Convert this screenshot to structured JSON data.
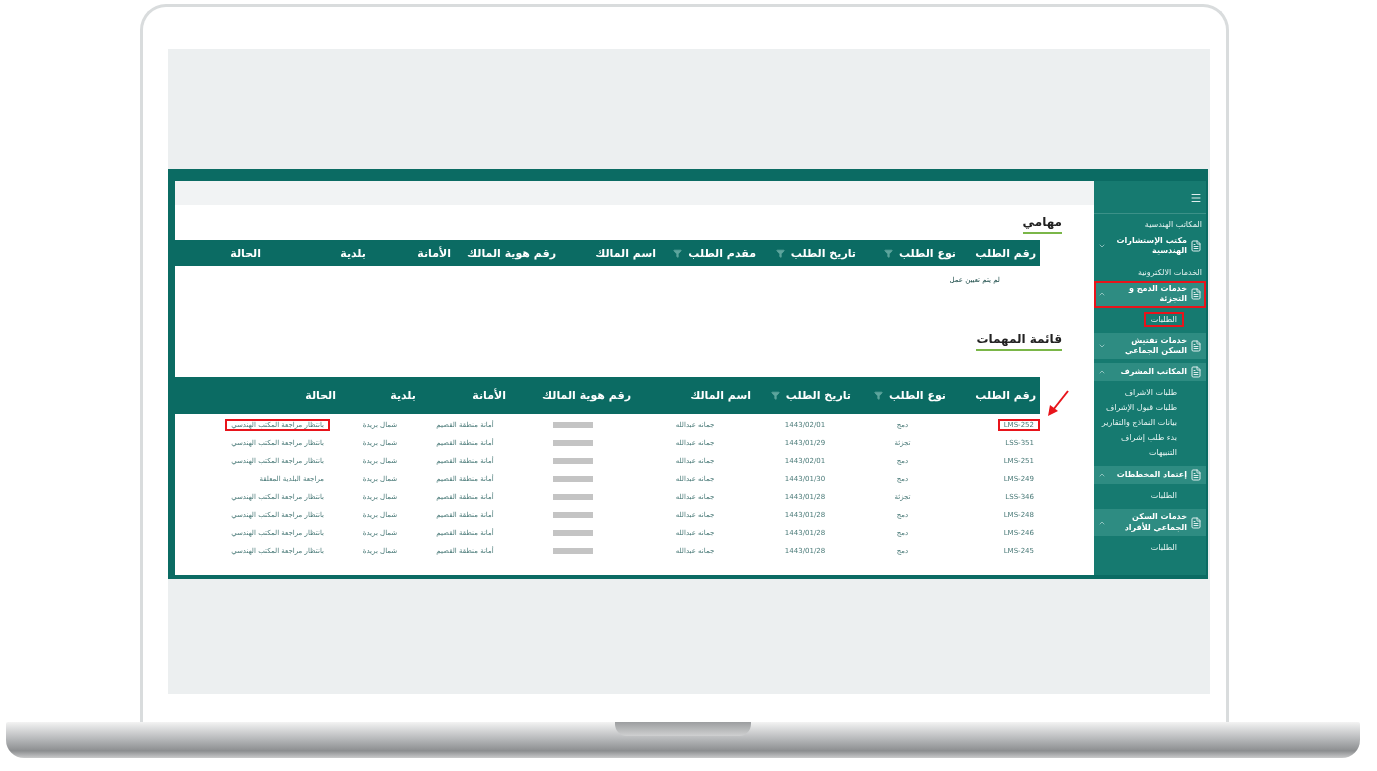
{
  "sidebar": {
    "groups": [
      {
        "label": "المكاتب الهندسية",
        "items": [
          {
            "label": "مكتب الإستشارات الهندسية",
            "expanded": false,
            "highlighted": false
          }
        ]
      },
      {
        "label": "الخدمات الالكترونية",
        "items": [
          {
            "label": "خدمات الدمج و التجزئة",
            "expanded": true,
            "highlighted": true,
            "children": [
              {
                "label": "الطلبات",
                "highlighted": true
              }
            ]
          },
          {
            "label": "خدمات تفتيش السكن الجماعي",
            "expanded": false,
            "highlighted": false
          },
          {
            "label": "المكاتب المشرف",
            "expanded": true,
            "highlighted": false,
            "children": [
              {
                "label": "طلبات الاشراف",
                "highlighted": false
              },
              {
                "label": "طلبات قبول الإشراف",
                "highlighted": false
              },
              {
                "label": "بيانات النماذج والتقارير",
                "highlighted": false
              },
              {
                "label": "بدء طلب إشراف",
                "highlighted": false
              },
              {
                "label": "التنبيهات",
                "highlighted": false
              }
            ]
          },
          {
            "label": "إعتماد المخططات",
            "expanded": true,
            "highlighted": false,
            "children": [
              {
                "label": "الطلبات",
                "highlighted": false
              }
            ]
          },
          {
            "label": "خدمات السكن الجماعي للأفراد",
            "expanded": true,
            "highlighted": false,
            "children": [
              {
                "label": "الطلبات",
                "highlighted": false
              }
            ]
          }
        ]
      }
    ]
  },
  "my_tasks": {
    "title": "مهامي",
    "columns": [
      {
        "label": "رقم الطلب",
        "filter": false
      },
      {
        "label": "نوع الطلب",
        "filter": true
      },
      {
        "label": "تاريخ الطلب",
        "filter": true
      },
      {
        "label": "مقدم الطلب",
        "filter": true
      },
      {
        "label": "اسم المالك",
        "filter": false
      },
      {
        "label": "رقم هوية المالك",
        "filter": false
      },
      {
        "label": "الأمانة",
        "filter": false
      },
      {
        "label": "بلدية",
        "filter": false
      },
      {
        "label": "الحالة",
        "filter": false
      }
    ],
    "empty_message": "لم يتم تعيين عمل"
  },
  "task_list": {
    "title": "قائمة المهمات",
    "columns": [
      {
        "label": "رقم الطلب",
        "filter": false
      },
      {
        "label": "نوع الطلب",
        "filter": true
      },
      {
        "label": "تاريخ الطلب",
        "filter": true
      },
      {
        "label": "اسم المالك",
        "filter": false
      },
      {
        "label": "رقم هوية المالك",
        "filter": false
      },
      {
        "label": "الأمانة",
        "filter": false
      },
      {
        "label": "بلدية",
        "filter": false
      },
      {
        "label": "الحالة",
        "filter": false
      }
    ],
    "rows": [
      {
        "id": "LMS-252",
        "id_highlighted": true,
        "type": "دمج",
        "date": "1443/02/01",
        "owner": "جمانه عبدالله",
        "amana": "أمانة منطقة القصيم",
        "municipality": "شمال بريدة",
        "status": "بانتظار مراجعة المكتب الهندسي",
        "status_highlighted": true
      },
      {
        "id": "LSS-351",
        "id_highlighted": false,
        "type": "تجزئة",
        "date": "1443/01/29",
        "owner": "جمانه عبدالله",
        "amana": "أمانة منطقة القصيم",
        "municipality": "شمال بريدة",
        "status": "بانتظار مراجعة المكتب الهندسي",
        "status_highlighted": false
      },
      {
        "id": "LMS-251",
        "id_highlighted": false,
        "type": "دمج",
        "date": "1443/02/01",
        "owner": "جمانه عبدالله",
        "amana": "أمانة منطقة القصيم",
        "municipality": "شمال بريدة",
        "status": "بانتظار مراجعة المكتب الهندسي",
        "status_highlighted": false
      },
      {
        "id": "LMS-249",
        "id_highlighted": false,
        "type": "دمج",
        "date": "1443/01/30",
        "owner": "جمانه عبدالله",
        "amana": "أمانة منطقة القصيم",
        "municipality": "شمال بريدة",
        "status": "مراجعة البلدية المعلقة",
        "status_highlighted": false
      },
      {
        "id": "LSS-346",
        "id_highlighted": false,
        "type": "تجزئة",
        "date": "1443/01/28",
        "owner": "جمانه عبدالله",
        "amana": "أمانة منطقة القصيم",
        "municipality": "شمال بريدة",
        "status": "بانتظار مراجعة المكتب الهندسي",
        "status_highlighted": false
      },
      {
        "id": "LMS-248",
        "id_highlighted": false,
        "type": "دمج",
        "date": "1443/01/28",
        "owner": "جمانه عبدالله",
        "amana": "أمانة منطقة القصيم",
        "municipality": "شمال بريدة",
        "status": "بانتظار مراجعة المكتب الهندسي",
        "status_highlighted": false
      },
      {
        "id": "LMS-246",
        "id_highlighted": false,
        "type": "دمج",
        "date": "1443/01/28",
        "owner": "جمانه عبدالله",
        "amana": "أمانة منطقة القصيم",
        "municipality": "شمال بريدة",
        "status": "بانتظار مراجعة المكتب الهندسي",
        "status_highlighted": false
      },
      {
        "id": "LMS-245",
        "id_highlighted": false,
        "type": "دمج",
        "date": "1443/01/28",
        "owner": "جمانه عبدالله",
        "amana": "أمانة منطقة القصيم",
        "municipality": "شمال بريدة",
        "status": "بانتظار مراجعة المكتب الهندسي",
        "status_highlighted": false
      }
    ]
  }
}
